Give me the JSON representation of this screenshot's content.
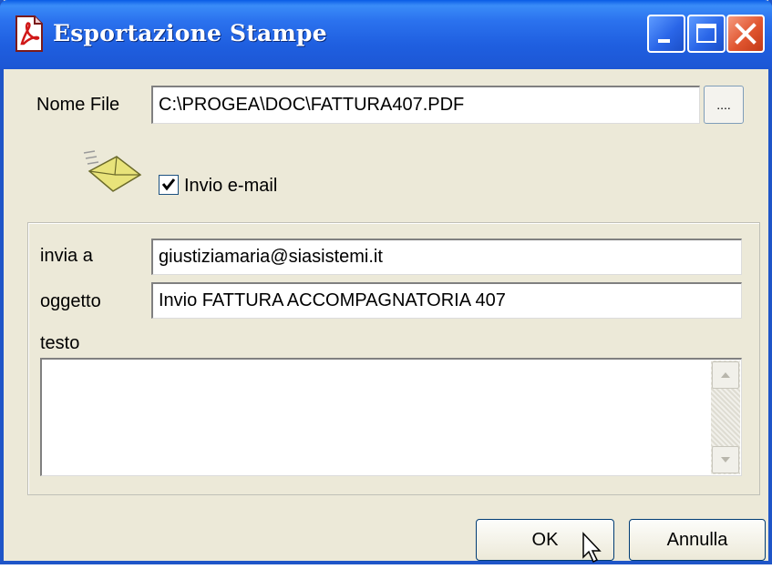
{
  "window": {
    "title": "Esportazione Stampe",
    "controls": {
      "minimize": "minimize-icon",
      "maximize": "maximize-icon",
      "close": "close-icon"
    }
  },
  "file": {
    "label": "Nome File",
    "value": "C:\\PROGEA\\DOC\\FATTURA407.PDF",
    "browse_label": "...."
  },
  "email_toggle": {
    "icon": "envelope-icon",
    "label": "Invio e-mail",
    "checked": true
  },
  "email": {
    "to_label": "invia a",
    "to_value": "giustiziamaria@siasistemi.it",
    "subject_label": "oggetto",
    "subject_value": "Invio FATTURA  ACCOMPAGNATORIA 407",
    "body_label": "testo",
    "body_value": ""
  },
  "buttons": {
    "ok": "OK",
    "cancel": "Annulla"
  },
  "colors": {
    "titlebar": "#1f5fe0",
    "dialog_bg": "#ece9d8",
    "close_button": "#e0552f"
  }
}
